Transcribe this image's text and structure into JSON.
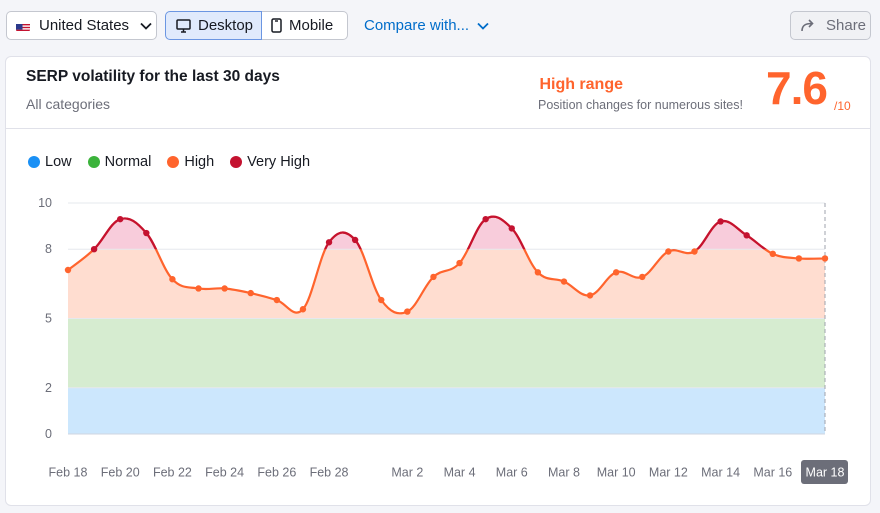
{
  "toolbar": {
    "country": "United States",
    "desktop": "Desktop",
    "mobile": "Mobile",
    "compare": "Compare with...",
    "share": "Share"
  },
  "card": {
    "title": "SERP volatility for the last 30 days",
    "subtitle": "All categories",
    "range_title": "High range",
    "range_desc": "Position changes for numerous sites!",
    "score": "7.6",
    "score_max": "/10"
  },
  "legend": [
    {
      "label": "Low",
      "color": "#1a90f5"
    },
    {
      "label": "Normal",
      "color": "#3bb33b"
    },
    {
      "label": "High",
      "color": "#ff642d"
    },
    {
      "label": "Very High",
      "color": "#c41230"
    }
  ],
  "chart_data": {
    "type": "area",
    "title": "SERP volatility for the last 30 days",
    "x": [
      "Feb 18",
      "Feb 19",
      "Feb 20",
      "Feb 21",
      "Feb 22",
      "Feb 23",
      "Feb 24",
      "Feb 25",
      "Feb 26",
      "Feb 27",
      "Feb 28",
      "Feb 29",
      "Mar 1",
      "Mar 2",
      "Mar 3",
      "Mar 4",
      "Mar 5",
      "Mar 6",
      "Mar 7",
      "Mar 8",
      "Mar 9",
      "Mar 10",
      "Mar 11",
      "Mar 12",
      "Mar 13",
      "Mar 14",
      "Mar 15",
      "Mar 16",
      "Mar 17",
      "Mar 18"
    ],
    "x_tick_labels": [
      "Feb 18",
      "Feb 20",
      "Feb 22",
      "Feb 24",
      "Feb 26",
      "Feb 28",
      "Mar 2",
      "Mar 4",
      "Mar 6",
      "Mar 8",
      "Mar 10",
      "Mar 12",
      "Mar 14",
      "Mar 16",
      "Mar 18"
    ],
    "selected_x": "Mar 18",
    "y_ticks": [
      0,
      2,
      5,
      8,
      10
    ],
    "ylim": [
      0,
      10
    ],
    "bands": [
      {
        "name": "Low",
        "from": 0,
        "to": 2,
        "color": "#cce7fd"
      },
      {
        "name": "Normal",
        "from": 2,
        "to": 5,
        "color": "#d6ecd0"
      },
      {
        "name": "High",
        "from": 5,
        "to": 8,
        "color": "#ffddd0"
      },
      {
        "name": "Very High",
        "from": 8,
        "to": 10,
        "color": "#f8ccdb"
      }
    ],
    "values": [
      7.1,
      8.0,
      9.3,
      8.7,
      6.7,
      6.3,
      6.3,
      6.1,
      5.8,
      5.4,
      8.3,
      8.4,
      5.8,
      5.3,
      6.8,
      7.4,
      9.3,
      8.9,
      7.0,
      6.6,
      6.0,
      7.0,
      6.8,
      7.9,
      7.9,
      9.2,
      8.6,
      7.8,
      7.6,
      7.6
    ],
    "line_colors": {
      "high": "#ff642d",
      "very_high": "#c41230"
    }
  }
}
